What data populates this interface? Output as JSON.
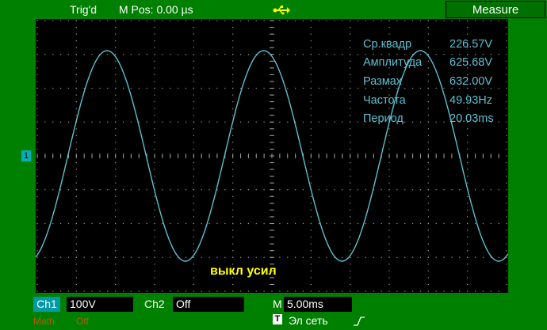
{
  "header": {
    "trigger_status": "Trig'd",
    "position_label": "M Pos: 0.00 µs",
    "usb_icon": "usb-icon",
    "measure_button": "Measure"
  },
  "measurements": [
    {
      "label": "Ср.квадр",
      "value": "226.57V"
    },
    {
      "label": "Амплитуда",
      "value": "625.68V"
    },
    {
      "label": "Размах",
      "value": "632.00V"
    },
    {
      "label": "Частота",
      "value": "49.93Hz"
    },
    {
      "label": "Период",
      "value": "20.03ms"
    }
  ],
  "overlay_text": "выкл усил",
  "channel_marker": "1",
  "bottom": {
    "ch1_label": "Ch1",
    "ch1_value": "100V",
    "ch2_label": "Ch2",
    "ch2_value": "Off",
    "timebase_label": "M",
    "timebase_value": "5.00ms",
    "math_label": "Math",
    "math_value": "Off",
    "trigger_badge": "T",
    "trigger_source": "Эл сеть",
    "trigger_slope_icon": "rising-edge-icon"
  },
  "colors": {
    "background": "#008000",
    "screen": "#000000",
    "trace": "#5fbfd0",
    "overlay": "#ffff00"
  },
  "waveform": {
    "type": "sine",
    "frequency_hz": 49.93,
    "period_ms": 20.03,
    "timebase_ms_per_div": 5.0
  }
}
